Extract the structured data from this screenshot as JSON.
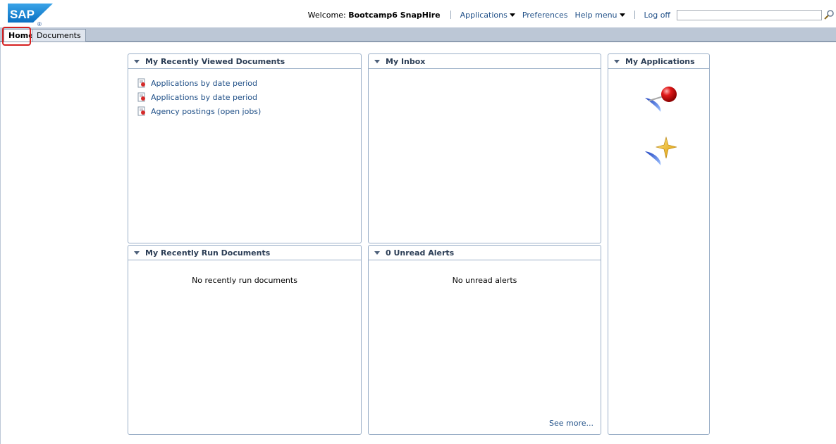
{
  "header": {
    "logo_text": "SAP",
    "welcome_prefix": "Welcome:",
    "user_name": "Bootcamp6 SnapHire",
    "nav": {
      "applications": "Applications",
      "preferences": "Preferences",
      "help_menu": "Help menu",
      "log_off": "Log off"
    },
    "search_value": ""
  },
  "tabs": [
    {
      "label": "Home",
      "active": true
    },
    {
      "label": "Documents",
      "active": false
    }
  ],
  "panels": {
    "recently_viewed": {
      "title": "My Recently Viewed Documents",
      "items": [
        "Applications by date period",
        "Applications by date period",
        "Agency postings (open jobs)"
      ]
    },
    "inbox": {
      "title": "My Inbox"
    },
    "applications": {
      "title": "My Applications",
      "icons": [
        "pushpin-app-icon",
        "star-app-icon"
      ]
    },
    "recently_run": {
      "title": "My Recently Run Documents",
      "empty_text": "No recently run documents"
    },
    "alerts": {
      "title": "0 Unread Alerts",
      "empty_text": "No unread alerts",
      "see_more": "See more..."
    }
  },
  "colors": {
    "link": "#1f4f87",
    "tabstrip": "#bcc7d6",
    "panel_border": "#9cb0c8",
    "highlight": "#d62020"
  }
}
